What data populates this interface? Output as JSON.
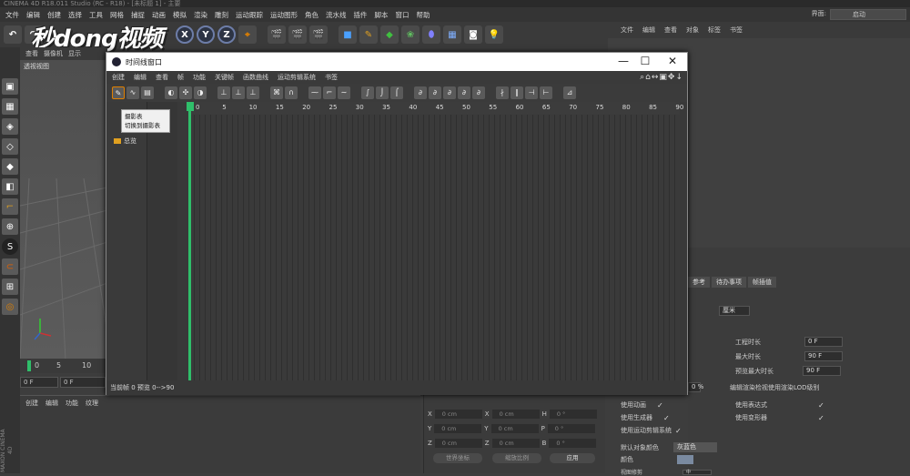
{
  "app": {
    "title": "CINEMA 4D R18.011 Studio (RC - R18) - [未标题 1] - 主要",
    "menus": [
      "文件",
      "编辑",
      "创建",
      "选择",
      "工具",
      "网格",
      "捕捉",
      "动画",
      "模拟",
      "渲染",
      "雕刻",
      "运动跟踪",
      "运动图形",
      "角色",
      "流水线",
      "插件",
      "脚本",
      "窗口",
      "帮助"
    ],
    "layout_label": "界面:",
    "layout_value": "启动"
  },
  "watermark": "秒dong视频",
  "toolbar": {
    "x_label": "X",
    "y_label": "Y",
    "z_label": "Z"
  },
  "viewport": {
    "menu": [
      "查看",
      "摄像机",
      "显示"
    ],
    "label": "透视视图",
    "ruler_ticks": [
      "0",
      "5",
      "10"
    ],
    "frame_start": "0 F",
    "frame_cur": "0 F"
  },
  "material": {
    "menu": [
      "创建",
      "编辑",
      "功能",
      "纹理"
    ]
  },
  "coords": {
    "rows": [
      {
        "a": "X",
        "av": "0 cm",
        "b": "X",
        "bv": "0 cm",
        "c": "H",
        "cv": "0 °"
      },
      {
        "a": "Y",
        "av": "0 cm",
        "b": "Y",
        "bv": "0 cm",
        "c": "P",
        "cv": "0 °"
      },
      {
        "a": "Z",
        "av": "0 cm",
        "b": "Z",
        "bv": "0 cm",
        "c": "B",
        "cv": "0 °"
      }
    ],
    "world": "世界坐标",
    "scale": "缩放比例",
    "apply": "应用"
  },
  "brand": "MAXON CINEMA 4D",
  "objects": {
    "menu": [
      "文件",
      "编辑",
      "查看",
      "对象",
      "标签",
      "书签"
    ]
  },
  "attributes": {
    "tabs": [
      "参考",
      "待办事项",
      "帧插值"
    ],
    "unit": "厘米",
    "rows_right": [
      {
        "label": "工程时长",
        "value": "0 F"
      },
      {
        "label": "最大时长",
        "value": "90 F"
      },
      {
        "label": "预览最大时长",
        "value": "90 F"
      }
    ],
    "lod_label": "编辑渲染检视使用渲染LOD级别",
    "pct": "0 %",
    "checks_left": [
      "使用动画",
      "使用生成器",
      "使用运动剪辑系统"
    ],
    "checks_right": [
      "使用表达式",
      "使用变形器"
    ],
    "default_color_label": "默认对象颜色",
    "default_color_value": "灰蓝色",
    "color_label": "颜色",
    "bottom_label": "视图修剪",
    "bottom_value": "中"
  },
  "timeline": {
    "title": "时间线窗口",
    "menu": [
      "创建",
      "编辑",
      "查看",
      "帧",
      "功能",
      "关键帧",
      "函数曲线",
      "运动剪辑系统",
      "书签"
    ],
    "tooltip_title": "摄影表",
    "tooltip_text": "切换到摄影表",
    "row_label": "总览",
    "ticks": [
      "0",
      "5",
      "10",
      "15",
      "20",
      "25",
      "30",
      "35",
      "40",
      "45",
      "50",
      "55",
      "60",
      "65",
      "70",
      "75",
      "80",
      "85",
      "90"
    ],
    "status": "当前帧 0  预览 0-->90",
    "window_controls": [
      "—",
      "☐",
      "✕"
    ]
  }
}
